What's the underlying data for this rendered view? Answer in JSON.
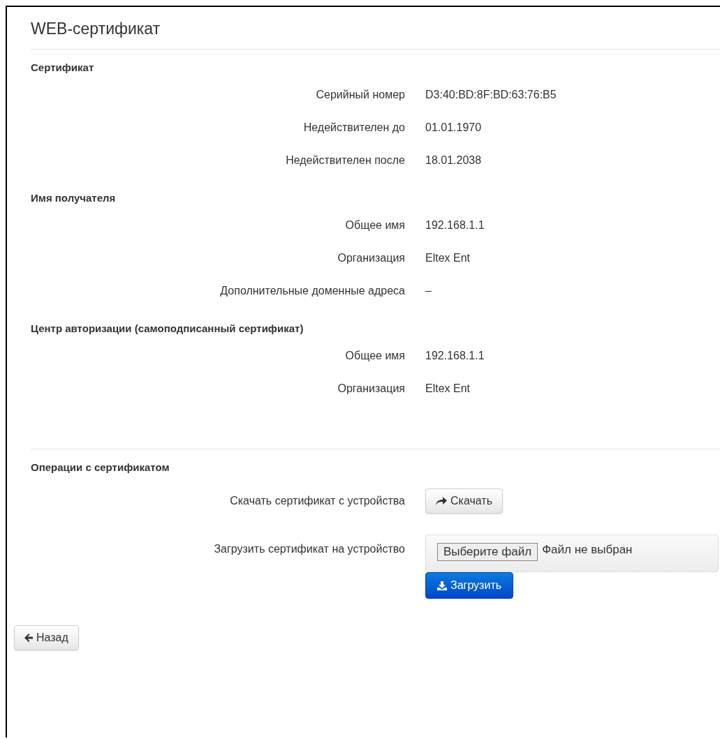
{
  "title": "WEB-сертификат",
  "sections": [
    {
      "heading": "Сертификат",
      "rows": [
        {
          "label": "Серийный номер",
          "value": "D3:40:BD:8F:BD:63:76:B5"
        },
        {
          "label": "Недействителен до",
          "value": "01.01.1970"
        },
        {
          "label": "Недействителен после",
          "value": "18.01.2038"
        }
      ]
    },
    {
      "heading": "Имя получателя",
      "rows": [
        {
          "label": "Общее имя",
          "value": "192.168.1.1"
        },
        {
          "label": "Организация",
          "value": "Eltex Ent"
        },
        {
          "label": "Дополнительные доменные адреса",
          "value": "–"
        }
      ]
    },
    {
      "heading": "Центр авторизации (самоподписанный сертификат)",
      "rows": [
        {
          "label": "Общее имя",
          "value": "192.168.1.1"
        },
        {
          "label": "Организация",
          "value": "Eltex Ent"
        }
      ]
    }
  ],
  "operations": {
    "heading": "Операции с сертификатом",
    "download": {
      "label": "Скачать сертификат с устройства",
      "button": "Скачать"
    },
    "upload": {
      "label": "Загрузить сертификат на устройство",
      "choose_button": "Выберите файл",
      "file_status": "Файл не выбран",
      "button": "Загрузить"
    }
  },
  "back_button": "Назад"
}
